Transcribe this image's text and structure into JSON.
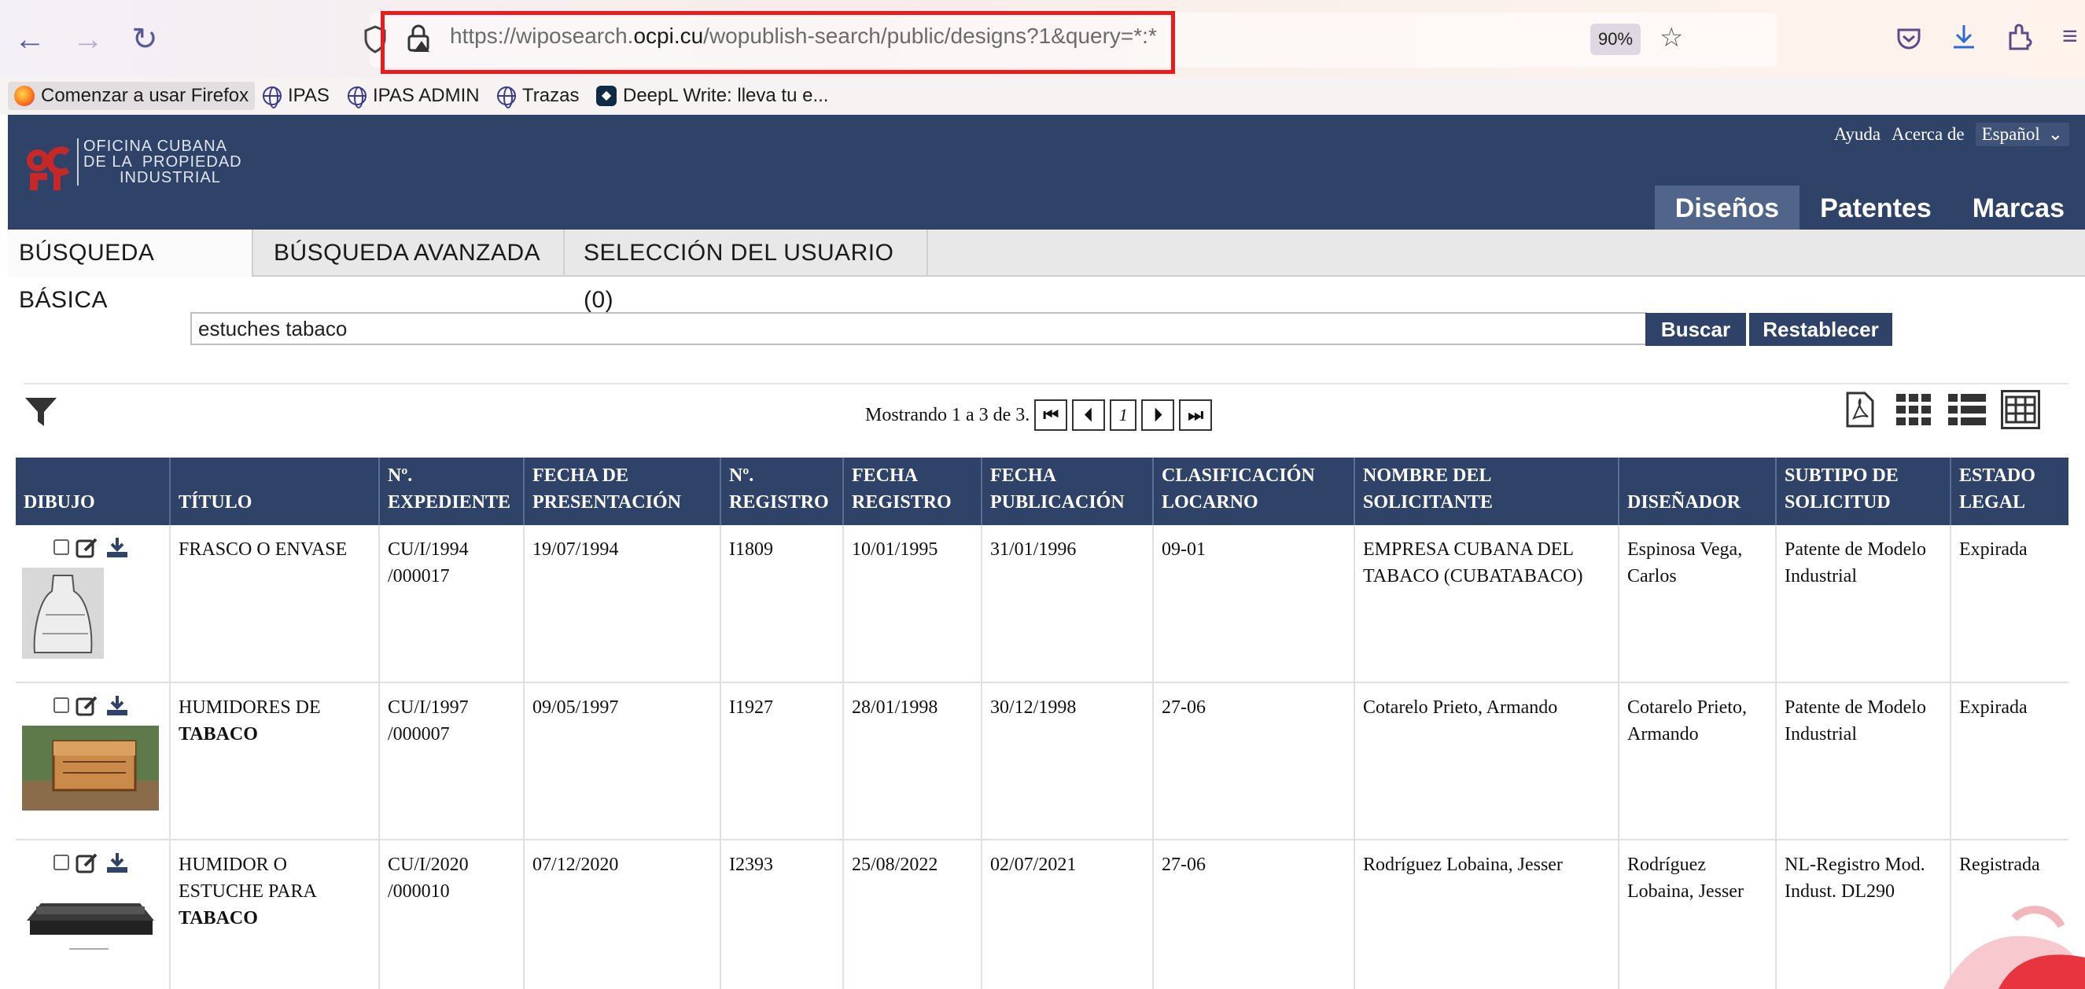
{
  "browser": {
    "url_prefix": "https://wiposearch.",
    "url_host": "ocpi.cu",
    "url_suffix": "/wopublish-search/public/designs?1&query=*:*",
    "zoom": "90%",
    "icons": [
      "back-icon",
      "forward-icon",
      "reload-icon",
      "shield-icon",
      "lock-icon",
      "star-icon",
      "pocket-icon",
      "download-icon",
      "extensions-icon",
      "menu-icon"
    ],
    "bookmarks": [
      "Comenzar a usar Firefox",
      "IPAS",
      "IPAS ADMIN",
      "Trazas",
      "DeepL Write: lleva tu e..."
    ]
  },
  "site": {
    "logo_lines": [
      "OFICINA CUBANA",
      "DE LA  PROPIEDAD",
      "INDUSTRIAL"
    ],
    "top_links": {
      "help": "Ayuda",
      "about": "Acerca de",
      "language": "Español"
    },
    "main_tabs": [
      "Diseños",
      "Patentes",
      "Marcas"
    ],
    "sub_tabs": [
      "BÚSQUEDA BÁSICA",
      "BÚSQUEDA AVANZADA",
      "SELECCIÓN DEL USUARIO (0)"
    ]
  },
  "search": {
    "value": "estuches tabaco",
    "search_label": "Buscar",
    "reset_label": "Restablecer"
  },
  "paging": {
    "text": "Mostrando 1 a 3 de 3.",
    "page": "1"
  },
  "table": {
    "headers": [
      "DIBUJO",
      "TÍTULO",
      "Nº. EXPEDIENTE",
      "FECHA DE PRESENTACIÓN",
      "Nº. REGISTRO",
      "FECHA REGISTRO",
      "FECHA PUBLICACIÓN",
      "CLASIFICACIÓN LOCARNO",
      "NOMBRE DEL SOLICITANTE",
      "DISEÑADOR",
      "SUBTIPO DE SOLICITUD",
      "ESTADO LEGAL"
    ],
    "rows": [
      {
        "title_pre": "FRASCO O ENVASE",
        "title_bold": "",
        "expediente": "CU/I/1994 /000017",
        "presentacion": "19/07/1994",
        "registro": "I1809",
        "fecha_registro": "10/01/1995",
        "publicacion": "31/01/1996",
        "locarno": "09-01",
        "solicitante": "EMPRESA CUBANA DEL TABACO (CUBATABACO)",
        "disenador": "Espinosa Vega, Carlos",
        "subtipo": "Patente de Modelo Industrial",
        "estado": "Expirada"
      },
      {
        "title_pre": "HUMIDORES DE ",
        "title_bold": "TABACO",
        "expediente": "CU/I/1997 /000007",
        "presentacion": "09/05/1997",
        "registro": "I1927",
        "fecha_registro": "28/01/1998",
        "publicacion": "30/12/1998",
        "locarno": "27-06",
        "solicitante": "Cotarelo Prieto, Armando",
        "disenador": "Cotarelo Prieto, Armando",
        "subtipo": "Patente de Modelo Industrial",
        "estado": "Expirada"
      },
      {
        "title_pre": "HUMIDOR O ESTUCHE PARA ",
        "title_bold": "TABACO",
        "expediente": "CU/I/2020 /000010",
        "presentacion": "07/12/2020",
        "registro": "I2393",
        "fecha_registro": "25/08/2022",
        "publicacion": "02/07/2021",
        "locarno": "27-06",
        "solicitante": "Rodríguez Lobaina, Jesser",
        "disenador": "Rodríguez Lobaina, Jesser",
        "subtipo": "NL-Registro Mod. Indust. DL290",
        "estado": "Registrada"
      }
    ]
  },
  "colors": {
    "header": "#2f4368",
    "active_tab": "#51648a",
    "highlight_box": "#e81c1c"
  }
}
